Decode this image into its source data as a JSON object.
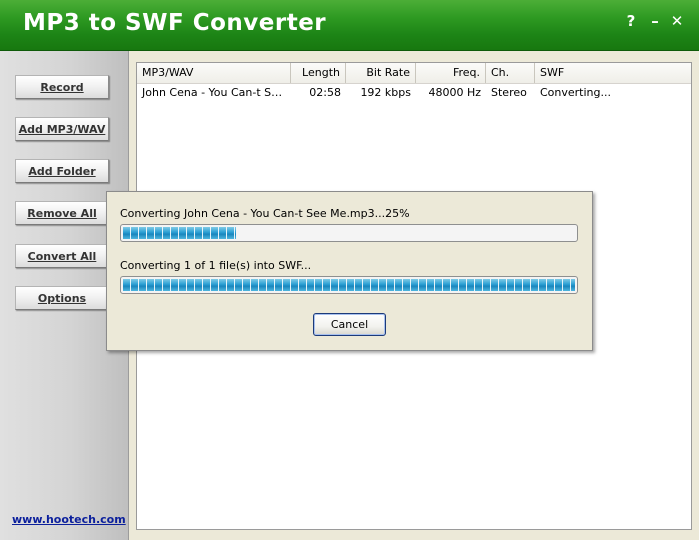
{
  "window": {
    "title": "MP3 to SWF Converter",
    "help": "?",
    "minimize": "–",
    "close": "✕"
  },
  "sidebar": {
    "buttons": [
      "Record",
      "Add MP3/WAV",
      "Add Folder",
      "Remove All",
      "Convert All",
      "Options"
    ],
    "link": "www.hootech.com"
  },
  "list": {
    "columns": [
      "MP3/WAV",
      "Length",
      "Bit Rate",
      "Freq.",
      "Ch.",
      "SWF"
    ],
    "rows": [
      [
        "John Cena - You Can-t See Me.mp3",
        "02:58",
        "192 kbps",
        "48000 Hz",
        "Stereo",
        "Converting..."
      ]
    ]
  },
  "dialog": {
    "file_status": "Converting John Cena - You Can-t See Me.mp3...25%",
    "file_progress": 0.25,
    "overall_status": "Converting 1 of 1 file(s) into SWF...",
    "overall_progress": 1.0,
    "cancel": "Cancel"
  },
  "colors": {
    "titlebar": "#1d8416",
    "progress": "#2a9ed3",
    "link": "#0b1f9c"
  }
}
